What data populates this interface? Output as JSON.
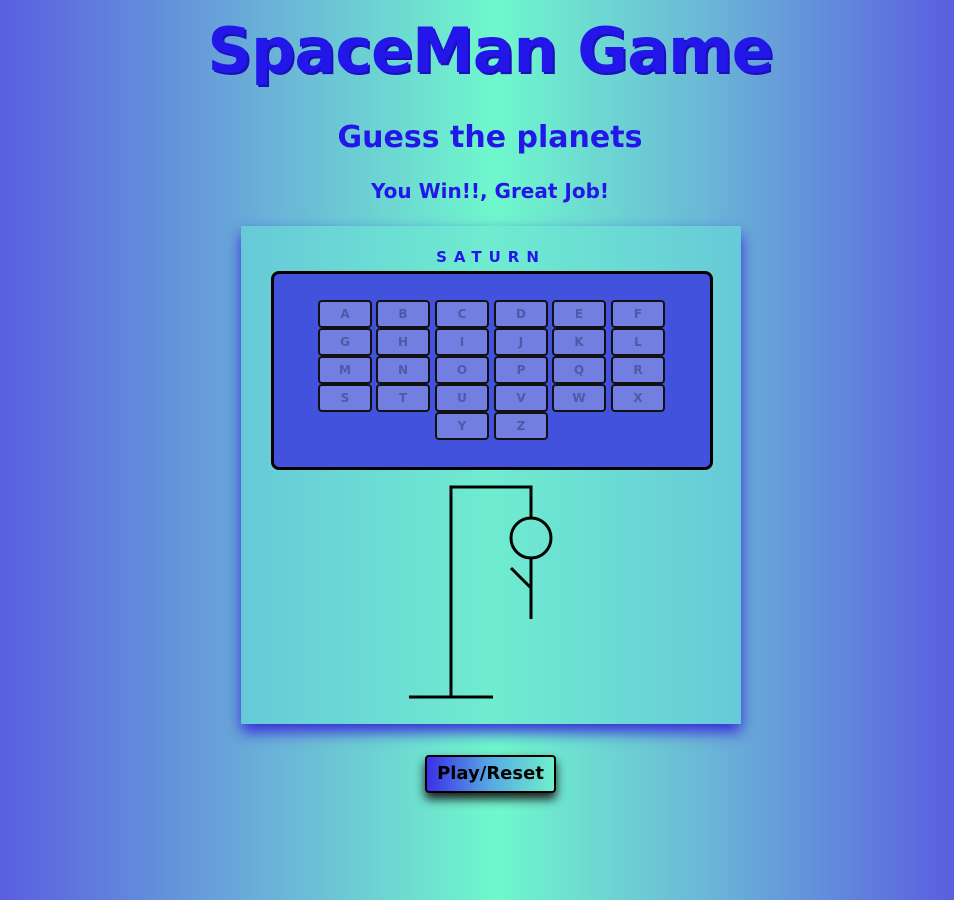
{
  "header": {
    "title": "SpaceMan Game",
    "subtitle": "Guess the planets",
    "status": "You Win!!, Great Job!"
  },
  "game": {
    "word": "SATURN",
    "keys": [
      "A",
      "B",
      "C",
      "D",
      "E",
      "F",
      "G",
      "H",
      "I",
      "J",
      "K",
      "L",
      "M",
      "N",
      "O",
      "P",
      "Q",
      "R",
      "S",
      "T",
      "U",
      "V",
      "W",
      "X",
      "Y",
      "Z"
    ]
  },
  "controls": {
    "play_reset_label": "Play/Reset"
  }
}
